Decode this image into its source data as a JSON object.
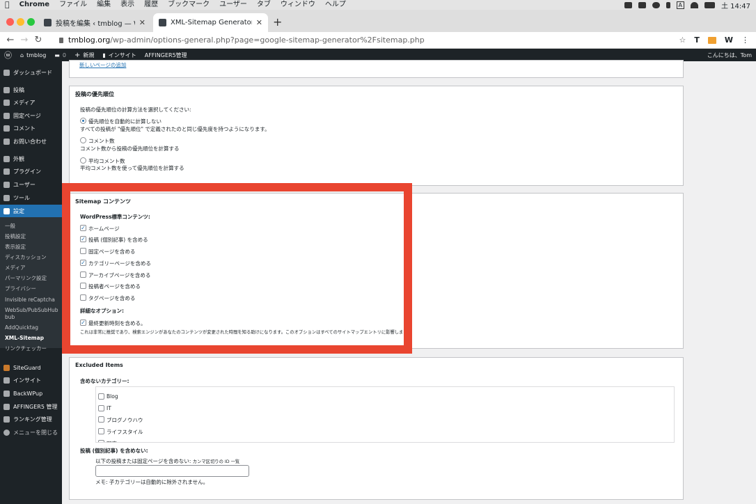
{
  "macos": {
    "app": "Chrome",
    "menus": [
      "ファイル",
      "編集",
      "表示",
      "履歴",
      "ブックマーク",
      "ユーザー",
      "タブ",
      "ウィンドウ",
      "ヘルプ"
    ],
    "clock": "土 14:47",
    "input_indicator": "A"
  },
  "browser": {
    "tabs": [
      {
        "title": "投稿を編集 ‹ tmblog — WordPress"
      },
      {
        "title": "XML-Sitemap Generator ‹ tmblog"
      }
    ],
    "new_tab": "+",
    "url_host": "tmblog.org",
    "url_path": "/wp-admin/options-general.php?page=google-sitemap-generator%2Fsitemap.php",
    "ext_labels": [
      "T",
      "W"
    ]
  },
  "adminbar": {
    "site": "tmblog",
    "comments": "0",
    "new": "新規",
    "insight": "インサイト",
    "affinger": "AFFINGER5管理",
    "greeting": "こんにちは、Tom"
  },
  "sidebar": {
    "items": [
      {
        "label": "ダッシュボード"
      },
      {
        "label": "投稿"
      },
      {
        "label": "メディア"
      },
      {
        "label": "固定ページ"
      },
      {
        "label": "コメント"
      },
      {
        "label": "お問い合わせ"
      },
      {
        "label": "外観"
      },
      {
        "label": "プラグイン"
      },
      {
        "label": "ユーザー"
      },
      {
        "label": "ツール"
      },
      {
        "label": "設定"
      }
    ],
    "submenu": [
      "一般",
      "投稿設定",
      "表示設定",
      "ディスカッション",
      "メディア",
      "パーマリンク設定",
      "プライバシー",
      "Invisible reCaptcha",
      "WebSub/PubSubHub",
      "bub",
      "AddQuicktag",
      "XML-Sitemap",
      "リンクチェッカー"
    ],
    "items2": [
      {
        "label": "SiteGuard"
      },
      {
        "label": "インサイト"
      },
      {
        "label": "BackWPup"
      },
      {
        "label": "AFFINGER5 管理"
      },
      {
        "label": "ランキング管理"
      },
      {
        "label": "メニューを閉じる"
      }
    ]
  },
  "page": {
    "top_link": "新しいページの追加",
    "priority": {
      "heading": "投稿の優先順位",
      "desc": "投稿の優先順位の計算方法を選択してください:",
      "options": [
        {
          "label": "優先順位を自動的に計算しない",
          "desc": "すべての投稿が \"優先順位\" で定義されたのと同じ優先度を持つようになります。",
          "selected": true
        },
        {
          "label": "コメント数",
          "desc": "コメント数から投稿の優先順位を計算する",
          "selected": false
        },
        {
          "label": "平均コメント数",
          "desc": "平均コメント数を使って優先順位を計算する",
          "selected": false
        }
      ]
    },
    "sitemap": {
      "heading": "Sitemap コンテンツ",
      "std_label": "WordPress標準コンテンツ:",
      "items": [
        {
          "label": "ホームページ",
          "checked": true
        },
        {
          "label": "投稿 (個別記事) を含める",
          "checked": true
        },
        {
          "label": "固定ページを含める",
          "checked": false
        },
        {
          "label": "カテゴリーページを含める",
          "checked": true
        },
        {
          "label": "アーカイブページを含める",
          "checked": false
        },
        {
          "label": "投稿者ページを含める",
          "checked": false
        },
        {
          "label": "タグページを含める",
          "checked": false
        }
      ],
      "adv_label": "詳細なオプション:",
      "lastmod_label": "最終更新時刻を含める。",
      "lastmod_checked": true,
      "lastmod_desc": "これは非常に推奨であり、検索エンジンがあなたのコンテンツが変更された時間を知る助けになります。このオプションはすべてのサイトマップエントリに影響します。"
    },
    "excluded": {
      "heading": "Excluded Items",
      "cat_label": "含めないカテゴリー:",
      "categories": [
        "Blog",
        "IT",
        "ブログノウハウ",
        "ライフスタイル",
        "写真"
      ],
      "posts_label": "投稿 (個別記事) を含めない:",
      "posts_hint_a": "以下の投稿または固定ページを含めない:",
      "posts_hint_b": "カンマ区切りの ID 一覧",
      "posts_value": "",
      "note": "メモ: 子カテゴリーは自動的に除外されません。"
    }
  },
  "colors": {
    "accent": "#2271b1",
    "highlight": "#e94530",
    "adminbar": "#1d2327"
  }
}
